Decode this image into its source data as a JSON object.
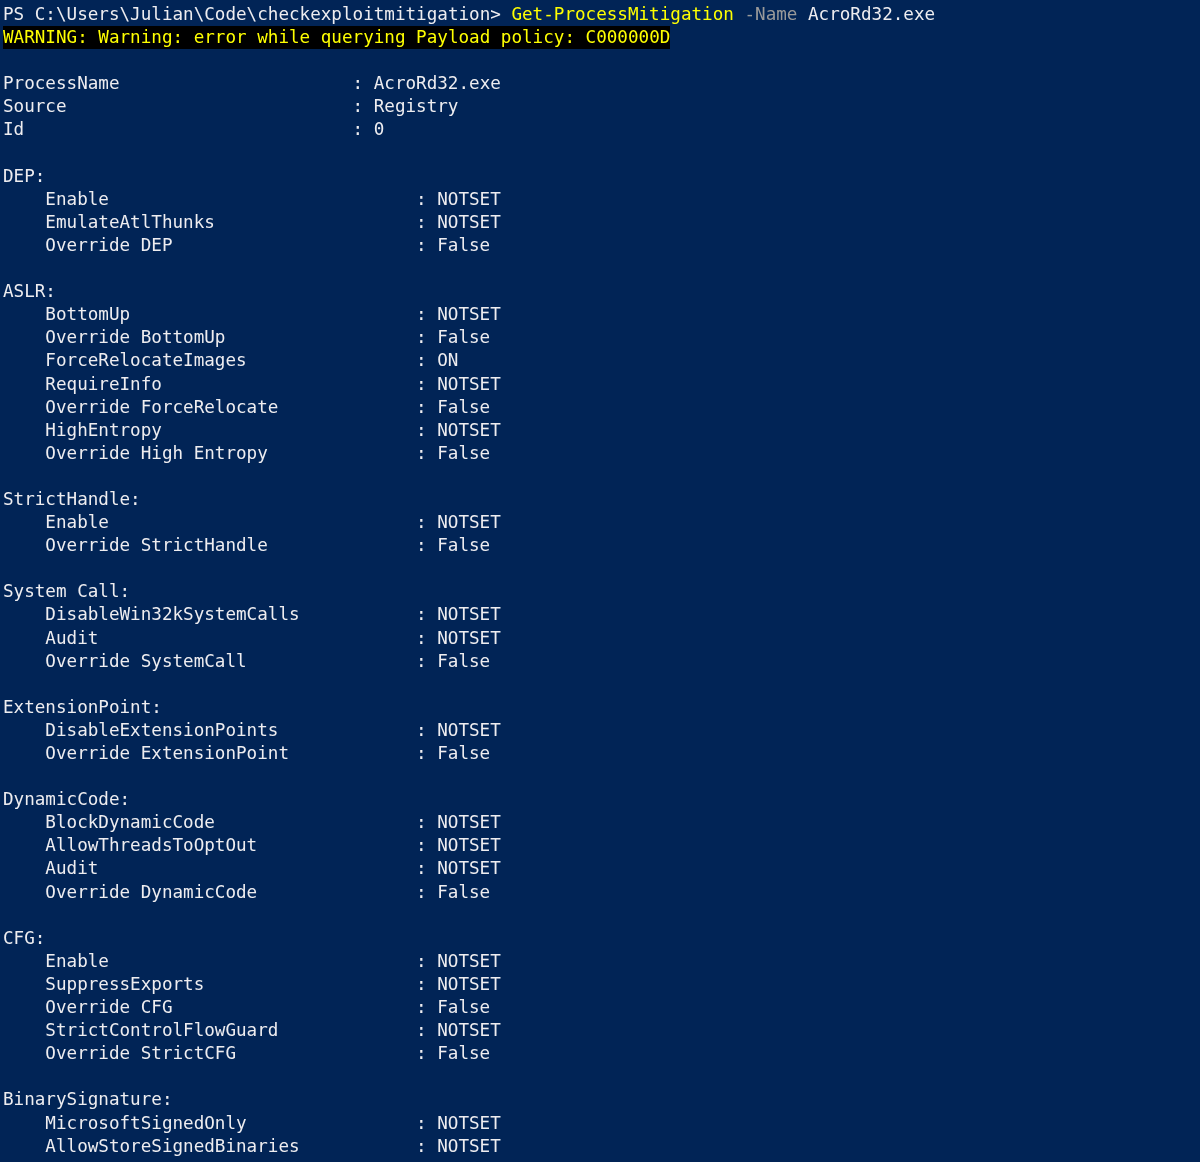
{
  "prompt": "PS C:\\Users\\Julian\\Code\\checkexploitmitigation>",
  "command": {
    "cmdlet": "Get-ProcessMitigation",
    "parameter": "-Name",
    "argument": "AcroRd32.exe"
  },
  "warning": "WARNING: Warning: error while querying Payload policy: C000000D",
  "separator": ":",
  "properties": [
    {
      "name": "ProcessName",
      "value": "AcroRd32.exe"
    },
    {
      "name": "Source",
      "value": "Registry"
    },
    {
      "name": "Id",
      "value": "0"
    }
  ],
  "sections": [
    {
      "title": "DEP:",
      "items": [
        {
          "name": "Enable",
          "value": "NOTSET"
        },
        {
          "name": "EmulateAtlThunks",
          "value": "NOTSET"
        },
        {
          "name": "Override DEP",
          "value": "False"
        }
      ]
    },
    {
      "title": "ASLR:",
      "items": [
        {
          "name": "BottomUp",
          "value": "NOTSET"
        },
        {
          "name": "Override BottomUp",
          "value": "False"
        },
        {
          "name": "ForceRelocateImages",
          "value": "ON"
        },
        {
          "name": "RequireInfo",
          "value": "NOTSET"
        },
        {
          "name": "Override ForceRelocate",
          "value": "False"
        },
        {
          "name": "HighEntropy",
          "value": "NOTSET"
        },
        {
          "name": "Override High Entropy",
          "value": "False"
        }
      ]
    },
    {
      "title": "StrictHandle:",
      "items": [
        {
          "name": "Enable",
          "value": "NOTSET"
        },
        {
          "name": "Override StrictHandle",
          "value": "False"
        }
      ]
    },
    {
      "title": "System Call:",
      "items": [
        {
          "name": "DisableWin32kSystemCalls",
          "value": "NOTSET"
        },
        {
          "name": "Audit",
          "value": "NOTSET"
        },
        {
          "name": "Override SystemCall",
          "value": "False"
        }
      ]
    },
    {
      "title": "ExtensionPoint:",
      "items": [
        {
          "name": "DisableExtensionPoints",
          "value": "NOTSET"
        },
        {
          "name": "Override ExtensionPoint",
          "value": "False"
        }
      ]
    },
    {
      "title": "DynamicCode:",
      "items": [
        {
          "name": "BlockDynamicCode",
          "value": "NOTSET"
        },
        {
          "name": "AllowThreadsToOptOut",
          "value": "NOTSET"
        },
        {
          "name": "Audit",
          "value": "NOTSET"
        },
        {
          "name": "Override DynamicCode",
          "value": "False"
        }
      ]
    },
    {
      "title": "CFG:",
      "items": [
        {
          "name": "Enable",
          "value": "NOTSET"
        },
        {
          "name": "SuppressExports",
          "value": "NOTSET"
        },
        {
          "name": "Override CFG",
          "value": "False"
        },
        {
          "name": "StrictControlFlowGuard",
          "value": "NOTSET"
        },
        {
          "name": "Override StrictCFG",
          "value": "False"
        }
      ]
    },
    {
      "title": "BinarySignature:",
      "items": [
        {
          "name": "MicrosoftSignedOnly",
          "value": "NOTSET"
        },
        {
          "name": "AllowStoreSignedBinaries",
          "value": "NOTSET"
        }
      ]
    }
  ]
}
